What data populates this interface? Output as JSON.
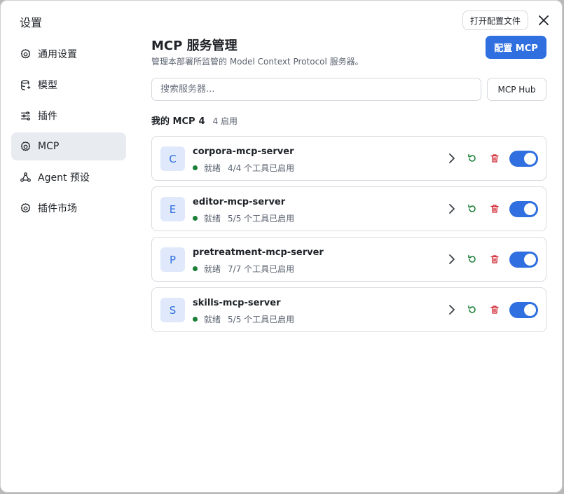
{
  "sidebar": {
    "title": "设置",
    "items": [
      {
        "label": "通用设置",
        "icon": "gear-icon",
        "active": false
      },
      {
        "label": "模型",
        "icon": "database-icon",
        "active": false
      },
      {
        "label": "插件",
        "icon": "sliders-icon",
        "active": false
      },
      {
        "label": "MCP",
        "icon": "gear-icon",
        "active": true
      },
      {
        "label": "Agent 预设",
        "icon": "agent-icon",
        "active": false
      },
      {
        "label": "插件市场",
        "icon": "gear-icon",
        "active": false
      }
    ]
  },
  "header": {
    "open_config_label": "打开配置文件",
    "close_icon": "close-icon"
  },
  "main": {
    "title": "MCP 服务管理",
    "subtitle": "管理本部署所监管的 Model Context Protocol 服务器。",
    "config_button": "配置 MCP",
    "search_placeholder": "搜索服务器...",
    "hub_button": "MCP Hub",
    "section_title": "我的 MCP",
    "section_count": "4",
    "section_enabled": "4 启用"
  },
  "servers": [
    {
      "initial": "C",
      "name": "corpora-mcp-server",
      "status": "就绪",
      "tools": "4/4 个工具已启用",
      "enabled": true
    },
    {
      "initial": "E",
      "name": "editor-mcp-server",
      "status": "就绪",
      "tools": "5/5 个工具已启用",
      "enabled": true
    },
    {
      "initial": "P",
      "name": "pretreatment-mcp-server",
      "status": "就绪",
      "tools": "7/7 个工具已启用",
      "enabled": true
    },
    {
      "initial": "S",
      "name": "skills-mcp-server",
      "status": "就绪",
      "tools": "5/5 个工具已启用",
      "enabled": true
    }
  ],
  "colors": {
    "accent": "#2f6fe0",
    "status_ready": "#1a7f37",
    "refresh": "#1a7f37",
    "delete": "#cf222e",
    "avatar_bg": "#dfe9fb"
  }
}
